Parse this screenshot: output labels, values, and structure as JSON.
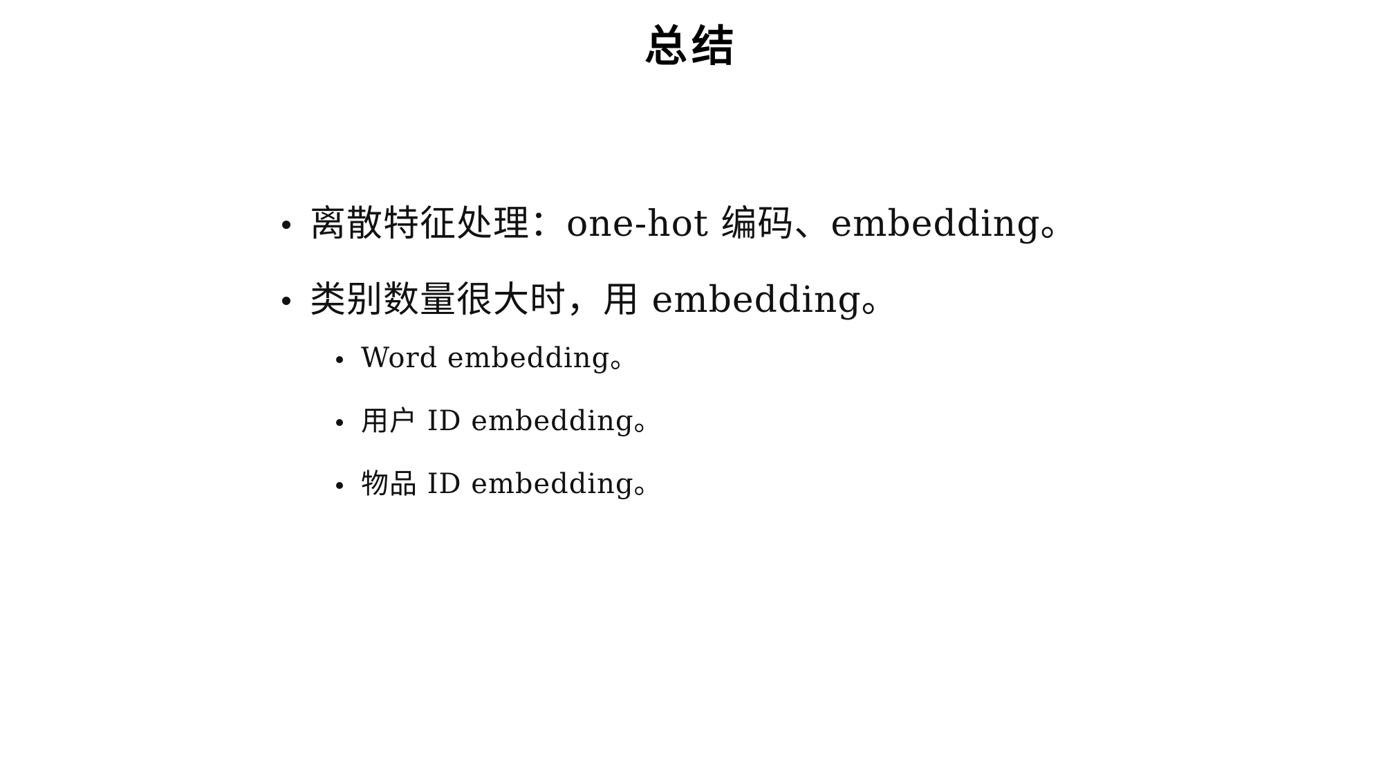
{
  "slide": {
    "title": "总结",
    "bullets": [
      {
        "text": "离散特征处理：one-hot 编码、embedding。"
      },
      {
        "text": "类别数量很大时，用 embedding。"
      }
    ],
    "sub_bullets": [
      {
        "text": "Word embedding。"
      },
      {
        "text": "用户 ID embedding。"
      },
      {
        "text": "物品 ID embedding。"
      }
    ]
  }
}
